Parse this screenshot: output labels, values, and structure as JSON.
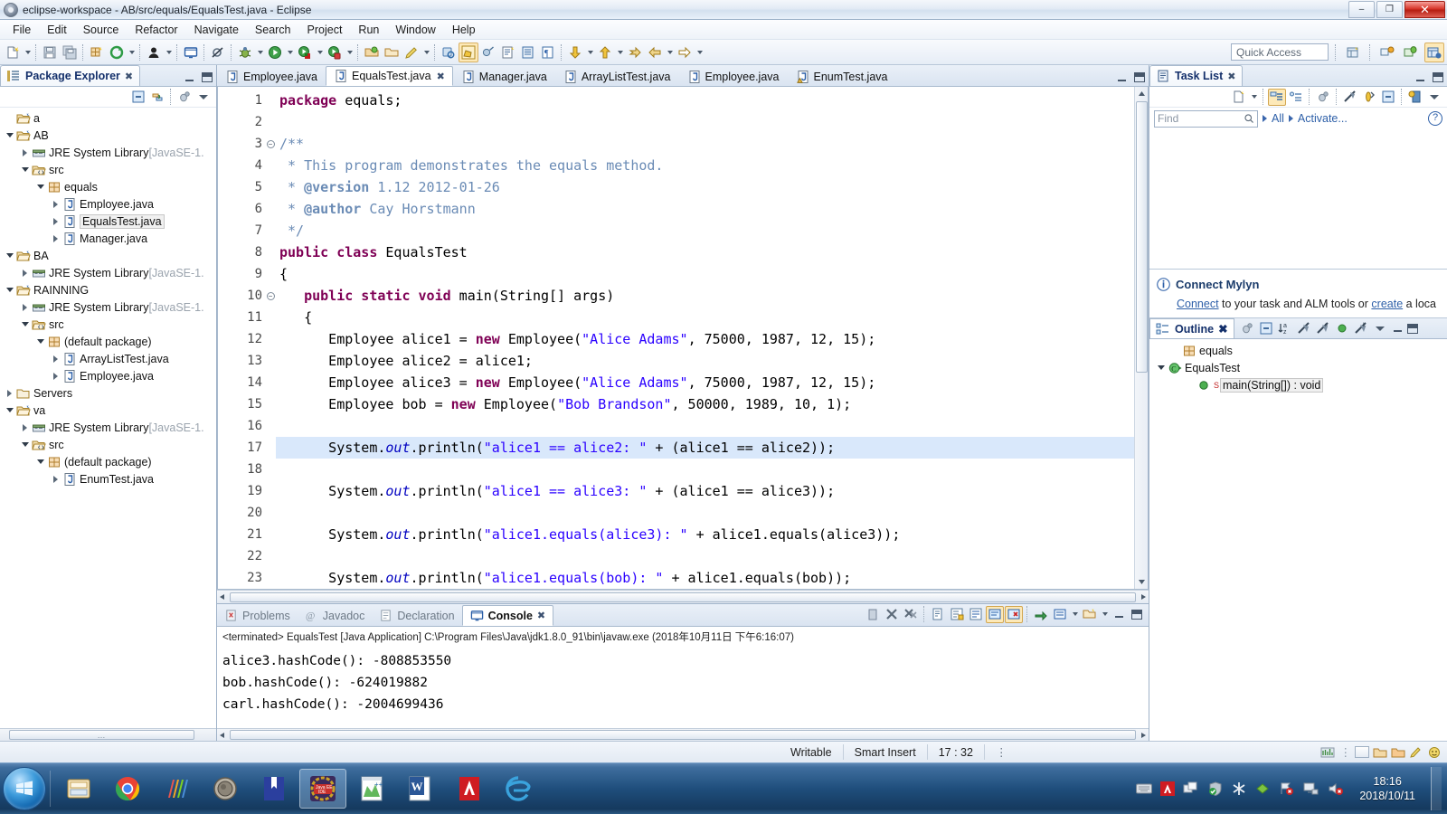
{
  "window": {
    "title": "eclipse-workspace - AB/src/equals/EqualsTest.java - Eclipse",
    "minimize_label": "–",
    "maximize_label": "❐",
    "close_label": "✕"
  },
  "menubar": {
    "items": [
      "File",
      "Edit",
      "Source",
      "Refactor",
      "Navigate",
      "Search",
      "Project",
      "Run",
      "Window",
      "Help"
    ]
  },
  "toolbar": {
    "quick_access_placeholder": "Quick Access",
    "icons": [
      "new-file-icon",
      "new-dropdown-icon",
      "save-icon",
      "save-all-icon",
      "new-package-icon",
      "refresh-icon",
      "refresh-dropdown-icon",
      "user-icon",
      "user-dropdown-icon",
      "console-icon",
      "skip-breakpoints-icon",
      "debug-icon",
      "debug-dropdown-icon",
      "run-icon",
      "run-dropdown-icon",
      "coverage-icon",
      "coverage-dropdown-icon",
      "profile-icon",
      "profile-dropdown-icon",
      "open-type-icon",
      "open-task-icon",
      "pencil-icon",
      "pencil-dropdown-icon",
      "search-icon",
      "java-perspective-icon",
      "extract-icon",
      "new-class-icon",
      "new-interface-icon",
      "new-annotation-icon",
      "next-annotation-icon",
      "next-dropdown-icon",
      "previous-annotation-icon",
      "previous-dropdown-icon",
      "back-icon",
      "back-alt-icon",
      "back-dropdown-icon",
      "forward-icon",
      "forward-dropdown-icon",
      "open-perspective-icon",
      "java-ee-perspective-icon",
      "debug-perspective-icon",
      "java-perspective-active-icon"
    ]
  },
  "package_explorer": {
    "tab_label": "Package Explorer",
    "close_glyph": "✖",
    "toolbar_icons": [
      "collapse-all-icon",
      "link-with-editor-icon",
      "focus-icon",
      "view-menu-icon"
    ],
    "tree": [
      {
        "label": "a",
        "indent": 0,
        "twisty": "none",
        "icon": "project-icon",
        "dim": false
      },
      {
        "label": "AB",
        "indent": 0,
        "twisty": "open",
        "icon": "project-icon",
        "dim": false
      },
      {
        "label": "JRE System Library",
        "suffix": " [JavaSE-1.",
        "indent": 1,
        "twisty": "closed",
        "icon": "library-icon",
        "dim": false
      },
      {
        "label": "src",
        "indent": 1,
        "twisty": "open",
        "icon": "source-folder-icon",
        "dim": false
      },
      {
        "label": "equals",
        "indent": 2,
        "twisty": "open",
        "icon": "package-icon",
        "dim": false
      },
      {
        "label": "Employee.java",
        "indent": 3,
        "twisty": "closed",
        "icon": "java-file-icon",
        "dim": false
      },
      {
        "label": "EqualsTest.java",
        "indent": 3,
        "twisty": "closed",
        "icon": "java-file-icon",
        "dim": false,
        "selected": true
      },
      {
        "label": "Manager.java",
        "indent": 3,
        "twisty": "closed",
        "icon": "java-file-icon",
        "dim": false
      },
      {
        "label": "BA",
        "indent": 0,
        "twisty": "open",
        "icon": "project-icon",
        "dim": false
      },
      {
        "label": "JRE System Library",
        "suffix": " [JavaSE-1.",
        "indent": 1,
        "twisty": "closed",
        "icon": "library-icon",
        "dim": false
      },
      {
        "label": "RAINNING",
        "indent": 0,
        "twisty": "open",
        "icon": "project-icon",
        "dim": false
      },
      {
        "label": "JRE System Library",
        "suffix": " [JavaSE-1.",
        "indent": 1,
        "twisty": "closed",
        "icon": "library-icon",
        "dim": false
      },
      {
        "label": "src",
        "indent": 1,
        "twisty": "open",
        "icon": "source-folder-icon",
        "dim": false
      },
      {
        "label": "(default package)",
        "indent": 2,
        "twisty": "open",
        "icon": "package-icon",
        "dim": false
      },
      {
        "label": "ArrayListTest.java",
        "indent": 3,
        "twisty": "closed",
        "icon": "java-file-icon",
        "dim": false
      },
      {
        "label": "Employee.java",
        "indent": 3,
        "twisty": "closed",
        "icon": "java-file-icon",
        "dim": false
      },
      {
        "label": "Servers",
        "indent": 0,
        "twisty": "closed",
        "icon": "folder-icon",
        "dim": false
      },
      {
        "label": "va",
        "indent": 0,
        "twisty": "open",
        "icon": "project-icon",
        "dim": false
      },
      {
        "label": "JRE System Library",
        "suffix": " [JavaSE-1.",
        "indent": 1,
        "twisty": "closed",
        "icon": "library-icon",
        "dim": false
      },
      {
        "label": "src",
        "indent": 1,
        "twisty": "open",
        "icon": "source-folder-icon",
        "dim": false
      },
      {
        "label": "(default package)",
        "indent": 2,
        "twisty": "open",
        "icon": "package-icon",
        "dim": false
      },
      {
        "label": "EnumTest.java",
        "indent": 3,
        "twisty": "closed",
        "icon": "java-file-icon",
        "dim": false
      }
    ],
    "hscroll_grip": "…"
  },
  "editor": {
    "tabs": [
      {
        "label": "Employee.java",
        "active": false,
        "icon": "java-file-icon"
      },
      {
        "label": "EqualsTest.java",
        "active": true,
        "icon": "java-file-icon",
        "close_glyph": "✖"
      },
      {
        "label": "Manager.java",
        "active": false,
        "icon": "java-file-icon"
      },
      {
        "label": "ArrayListTest.java",
        "active": false,
        "icon": "java-file-icon"
      },
      {
        "label": "Employee.java",
        "active": false,
        "icon": "java-file-icon"
      },
      {
        "label": "EnumTest.java",
        "active": false,
        "icon": "java-file-icon-warn"
      }
    ],
    "lines": [
      {
        "no": "1",
        "fold": "",
        "highlight": false,
        "tokens": [
          {
            "t": "package",
            "c": "kw"
          },
          {
            "t": " equals;",
            "c": "plain"
          }
        ]
      },
      {
        "no": "2",
        "fold": "",
        "highlight": false,
        "tokens": []
      },
      {
        "no": "3",
        "fold": "open",
        "highlight": false,
        "tokens": [
          {
            "t": "/**",
            "c": "doc"
          }
        ]
      },
      {
        "no": "4",
        "fold": "",
        "highlight": false,
        "tokens": [
          {
            "t": " * This program demonstrates the equals method.",
            "c": "doc"
          }
        ]
      },
      {
        "no": "5",
        "fold": "",
        "highlight": false,
        "tokens": [
          {
            "t": " * ",
            "c": "doc"
          },
          {
            "t": "@version",
            "c": "docb"
          },
          {
            "t": " 1.12 2012-01-26",
            "c": "doc"
          }
        ]
      },
      {
        "no": "6",
        "fold": "",
        "highlight": false,
        "tokens": [
          {
            "t": " * ",
            "c": "doc"
          },
          {
            "t": "@author",
            "c": "docb"
          },
          {
            "t": " Cay Horstmann",
            "c": "doc"
          }
        ]
      },
      {
        "no": "7",
        "fold": "",
        "highlight": false,
        "tokens": [
          {
            "t": " */",
            "c": "doc"
          }
        ]
      },
      {
        "no": "8",
        "fold": "",
        "highlight": false,
        "tokens": [
          {
            "t": "public class",
            "c": "kw"
          },
          {
            "t": " EqualsTest",
            "c": "plain"
          }
        ]
      },
      {
        "no": "9",
        "fold": "",
        "highlight": false,
        "tokens": [
          {
            "t": "{",
            "c": "plain"
          }
        ]
      },
      {
        "no": "10",
        "fold": "open",
        "highlight": false,
        "tokens": [
          {
            "t": "   ",
            "c": "plain"
          },
          {
            "t": "public static void",
            "c": "kw"
          },
          {
            "t": " main(String[] args)",
            "c": "plain"
          }
        ]
      },
      {
        "no": "11",
        "fold": "",
        "highlight": false,
        "tokens": [
          {
            "t": "   {",
            "c": "plain"
          }
        ]
      },
      {
        "no": "12",
        "fold": "",
        "highlight": false,
        "tokens": [
          {
            "t": "      Employee alice1 = ",
            "c": "plain"
          },
          {
            "t": "new",
            "c": "kw"
          },
          {
            "t": " Employee(",
            "c": "plain"
          },
          {
            "t": "\"Alice Adams\"",
            "c": "str"
          },
          {
            "t": ", 75000, 1987, 12, 15);",
            "c": "plain"
          }
        ]
      },
      {
        "no": "13",
        "fold": "",
        "highlight": false,
        "tokens": [
          {
            "t": "      Employee alice2 = alice1;",
            "c": "plain"
          }
        ]
      },
      {
        "no": "14",
        "fold": "",
        "highlight": false,
        "tokens": [
          {
            "t": "      Employee alice3 = ",
            "c": "plain"
          },
          {
            "t": "new",
            "c": "kw"
          },
          {
            "t": " Employee(",
            "c": "plain"
          },
          {
            "t": "\"Alice Adams\"",
            "c": "str"
          },
          {
            "t": ", 75000, 1987, 12, 15);",
            "c": "plain"
          }
        ]
      },
      {
        "no": "15",
        "fold": "",
        "highlight": false,
        "tokens": [
          {
            "t": "      Employee bob = ",
            "c": "plain"
          },
          {
            "t": "new",
            "c": "kw"
          },
          {
            "t": " Employee(",
            "c": "plain"
          },
          {
            "t": "\"Bob Brandson\"",
            "c": "str"
          },
          {
            "t": ", 50000, 1989, 10, 1);",
            "c": "plain"
          }
        ]
      },
      {
        "no": "16",
        "fold": "",
        "highlight": false,
        "tokens": []
      },
      {
        "no": "17",
        "fold": "",
        "highlight": true,
        "tokens": [
          {
            "t": "      System.",
            "c": "plain"
          },
          {
            "t": "out",
            "c": "field"
          },
          {
            "t": ".println(",
            "c": "plain"
          },
          {
            "t": "\"alice1 == alice2: \"",
            "c": "str"
          },
          {
            "t": " + (alice1 == alice2));",
            "c": "plain"
          }
        ]
      },
      {
        "no": "18",
        "fold": "",
        "highlight": false,
        "tokens": []
      },
      {
        "no": "19",
        "fold": "",
        "highlight": false,
        "tokens": [
          {
            "t": "      System.",
            "c": "plain"
          },
          {
            "t": "out",
            "c": "field"
          },
          {
            "t": ".println(",
            "c": "plain"
          },
          {
            "t": "\"alice1 == alice3: \"",
            "c": "str"
          },
          {
            "t": " + (alice1 == alice3));",
            "c": "plain"
          }
        ]
      },
      {
        "no": "20",
        "fold": "",
        "highlight": false,
        "tokens": []
      },
      {
        "no": "21",
        "fold": "",
        "highlight": false,
        "tokens": [
          {
            "t": "      System.",
            "c": "plain"
          },
          {
            "t": "out",
            "c": "field"
          },
          {
            "t": ".println(",
            "c": "plain"
          },
          {
            "t": "\"alice1.equals(alice3): \"",
            "c": "str"
          },
          {
            "t": " + alice1.equals(alice3));",
            "c": "plain"
          }
        ]
      },
      {
        "no": "22",
        "fold": "",
        "highlight": false,
        "tokens": []
      },
      {
        "no": "23",
        "fold": "",
        "highlight": false,
        "tokens": [
          {
            "t": "      System.",
            "c": "plain"
          },
          {
            "t": "out",
            "c": "field"
          },
          {
            "t": ".println(",
            "c": "plain"
          },
          {
            "t": "\"alice1.equals(bob): \"",
            "c": "str"
          },
          {
            "t": " + alice1.equals(bob));",
            "c": "plain"
          }
        ]
      }
    ]
  },
  "task_list": {
    "tab_label": "Task List",
    "close_glyph": "✖",
    "toolbar_icons": [
      "new-task-icon",
      "new-task-dropdown-icon",
      "categorized-icon",
      "scheduled-icon",
      "focus-icon",
      "collapse-all-icon",
      "synchronize-icon",
      "view-menu-icon"
    ],
    "find_placeholder": "Find",
    "filter_all": "All",
    "filter_activate": "Activate...",
    "help_glyph": "?"
  },
  "mylyn": {
    "title": "Connect Mylyn",
    "info_glyph": "ⓘ",
    "text_before": "",
    "link1": "Connect",
    "text_mid": " to your task and ALM tools or ",
    "link2": "create",
    "text_after": " a loca"
  },
  "outline": {
    "tab_label": "Outline",
    "close_glyph": "✖",
    "toolbar_icons": [
      "focus-icon",
      "collapse-all-icon",
      "sort-icon",
      "hide-fields-icon",
      "hide-static-icon",
      "hide-nonpublic-icon",
      "hide-local-icon",
      "view-menu-icon"
    ],
    "items": [
      {
        "label": "equals",
        "indent": 1,
        "twisty": "none",
        "icon": "package-icon"
      },
      {
        "label": "EqualsTest",
        "indent": 0,
        "twisty": "open",
        "icon": "class-icon"
      },
      {
        "label": "main(String[]) : void",
        "indent": 2,
        "twisty": "none",
        "icon": "method-public-icon",
        "badge": "S",
        "selected": true
      }
    ]
  },
  "console": {
    "tabs": [
      {
        "label": "Problems",
        "active": false,
        "icon": "problems-icon"
      },
      {
        "label": "Javadoc",
        "active": false,
        "icon": "javadoc-icon"
      },
      {
        "label": "Declaration",
        "active": false,
        "icon": "declaration-icon"
      },
      {
        "label": "Console",
        "active": true,
        "icon": "console-icon",
        "close_glyph": "✖"
      }
    ],
    "toolbar_icons": [
      "remove-icon",
      "terminate-icon",
      "remove-all-icon",
      "clear-console-icon",
      "scroll-lock-icon",
      "word-wrap-icon",
      "pin-console-icon",
      "display-selected-console-icon",
      "open-console-icon",
      "open-console-dropdown-icon",
      "new-console-view-icon",
      "new-console-dropdown-icon",
      "minimize-icon",
      "maximize-icon"
    ],
    "header": "<terminated> EqualsTest [Java Application] C:\\Program Files\\Java\\jdk1.8.0_91\\bin\\javaw.exe (2018年10月11日 下午6:16:07)",
    "output": [
      "alice3.hashCode(): -808853550",
      "bob.hashCode(): -624019882",
      "carl.hashCode(): -2004699436"
    ]
  },
  "statusbar": {
    "writable": "Writable",
    "insert_mode": "Smart Insert",
    "position": "17 : 32",
    "menu_glyph": "⋮"
  },
  "taskbar": {
    "start_label": "start-orb-icon",
    "items": [
      {
        "name": "windows-explorer-icon",
        "active": false
      },
      {
        "name": "google-chrome-icon",
        "active": false
      },
      {
        "name": "color-stripes-icon",
        "active": false
      },
      {
        "name": "coin-app-icon",
        "active": false
      },
      {
        "name": "bookmark-app-icon",
        "active": false
      },
      {
        "name": "java-ee-ide-icon",
        "active": true
      },
      {
        "name": "notepad-app-icon",
        "active": false
      },
      {
        "name": "microsoft-word-icon",
        "active": false
      },
      {
        "name": "adobe-acrobat-icon",
        "active": false
      },
      {
        "name": "internet-explorer-icon",
        "active": false
      }
    ],
    "tray_icons": [
      "keyboard-icon",
      "adobe-tray-icon",
      "windows-tray-icon",
      "shield-check-icon",
      "asterisk-icon",
      "green-diamond-icon",
      "flag-error-icon",
      "network-icon",
      "volume-mute-icon"
    ],
    "clock_time": "18:16",
    "clock_date": "2018/10/11"
  },
  "colors": {
    "accent": "#1f4e7c",
    "keyword": "#7f0055",
    "string": "#2a00ff",
    "javadoc": "#6a8bb5",
    "field": "#0000c0",
    "highlight_line": "#d9e8fb",
    "title_link": "#2d5fa8"
  }
}
